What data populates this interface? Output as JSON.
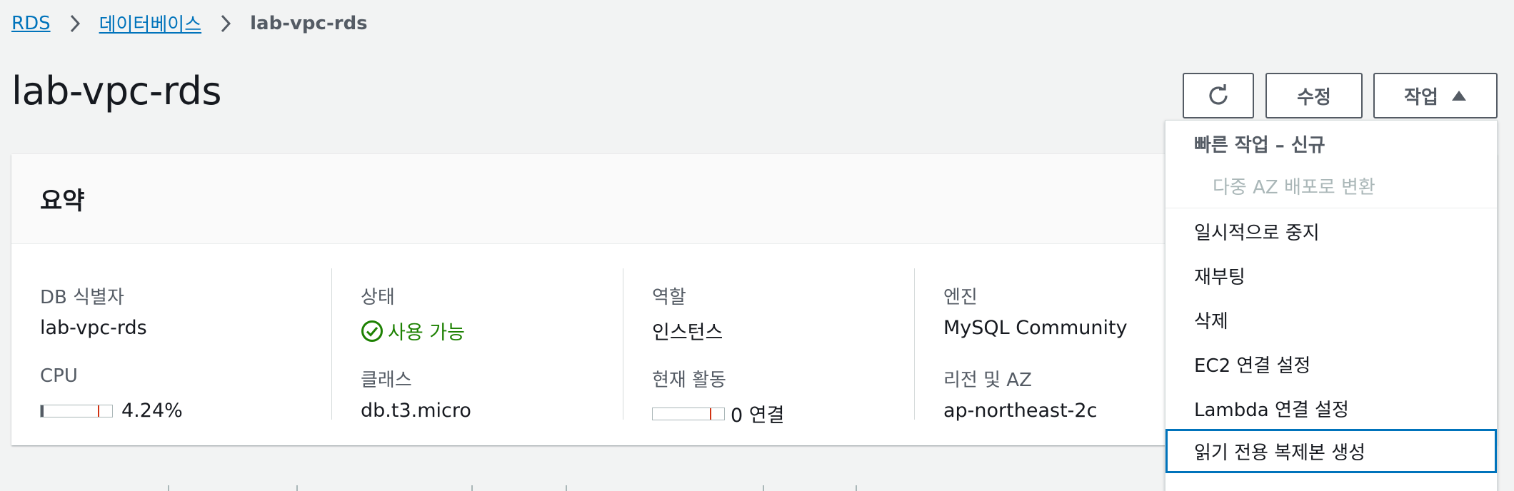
{
  "breadcrumb": {
    "items": [
      "RDS",
      "데이터베이스"
    ],
    "current": "lab-vpc-rds"
  },
  "header": {
    "title": "lab-vpc-rds",
    "edit_label": "수정",
    "actions_label": "작업"
  },
  "summary": {
    "title": "요약",
    "fields": {
      "db_identifier_label": "DB 식별자",
      "db_identifier_value": "lab-vpc-rds",
      "cpu_label": "CPU",
      "cpu_value": "4.24%",
      "status_label": "상태",
      "status_value": "사용 가능",
      "class_label": "클래스",
      "class_value": "db.t3.micro",
      "role_label": "역할",
      "role_value": "인스턴스",
      "activity_label": "현재 활동",
      "activity_value": "0 연결",
      "engine_label": "엔진",
      "engine_value": "MySQL Community",
      "region_label": "리전 및 AZ",
      "region_value": "ap-northeast-2c"
    },
    "cpu_fraction": 0.0424,
    "activity_fraction": 0.0
  },
  "actions_menu": {
    "group_title": "빠른 작업 – 신규",
    "group_items": [
      "다중 AZ 배포로 변환"
    ],
    "items": [
      "일시적으로 중지",
      "재부팅",
      "삭제",
      "EC2 연결 설정",
      "Lambda 연결 설정",
      "읽기 전용 복제본 생성"
    ],
    "focused_index": 5
  },
  "colors": {
    "link": "#0073bb",
    "status_ok": "#1d8102",
    "focus_border": "#0073bb",
    "threshold": "#d13212"
  }
}
